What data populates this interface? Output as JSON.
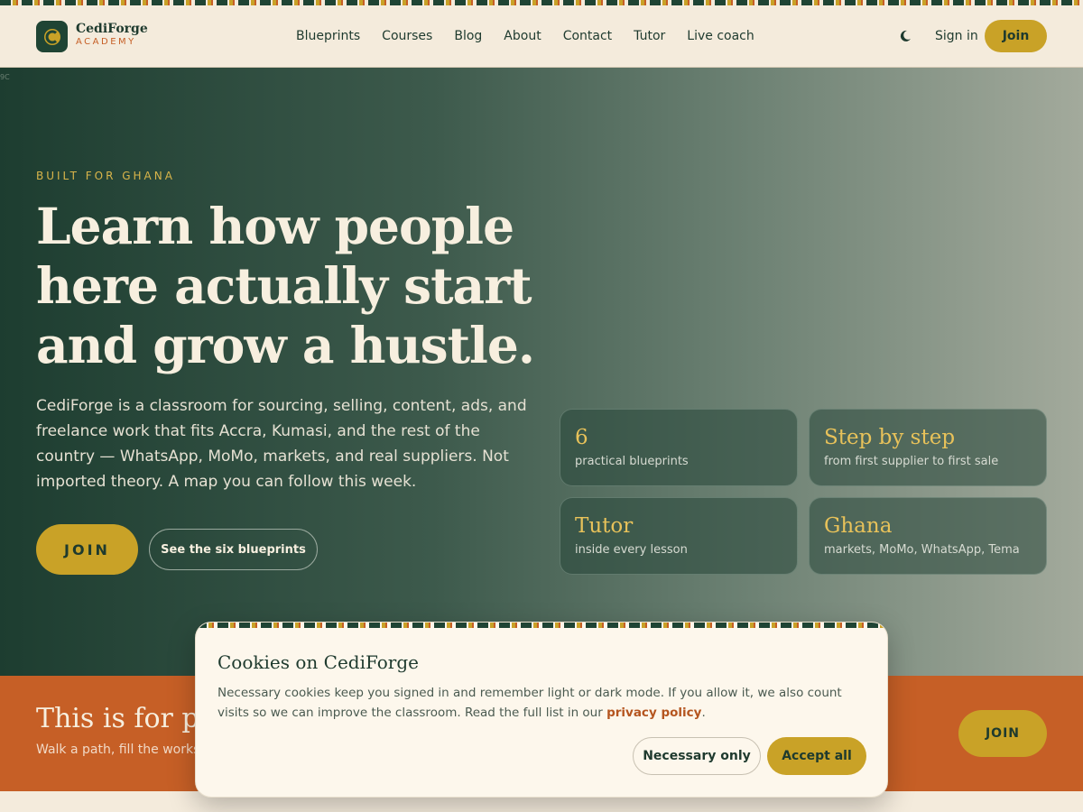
{
  "brand": {
    "name": "CediForge",
    "sub": "ACADEMY"
  },
  "nav": [
    "Blueprints",
    "Courses",
    "Blog",
    "About",
    "Contact",
    "Tutor",
    "Live coach"
  ],
  "header": {
    "signin": "Sign in",
    "join": "Join",
    "theme_icon": "moon-icon"
  },
  "hero": {
    "corner_text": "9C",
    "eyebrow": "BUILT FOR GHANA",
    "headline": "Learn how people here actually start and grow a hustle.",
    "lede": "CediForge is a classroom for sourcing, selling, content, ads, and freelance work that fits Accra, Kumasi, and the rest of the country — WhatsApp, MoMo, markets, and real suppliers. Not imported theory. A map you can follow this week.",
    "join": "JOIN",
    "see_blueprints": "See the six blueprints"
  },
  "stats": [
    {
      "big": "6",
      "small": "practical blueprints"
    },
    {
      "big": "Step by step",
      "small": "from first supplier to first sale"
    },
    {
      "big": "Tutor",
      "small": "inside every lesson"
    },
    {
      "big": "Ghana",
      "small": "markets, MoMo, WhatsApp, Tema"
    }
  ],
  "band": {
    "title": "This is for pe",
    "sub": "Walk a path, fill the worksh",
    "join": "JOIN"
  },
  "cookie": {
    "title": "Cookies on CediForge",
    "body": "Necessary cookies keep you signed in and remember light or dark mode. If you allow it, we also count visits so we can improve the classroom. Read the full list in our ",
    "link": "privacy policy",
    "end": ".",
    "necessary": "Necessary only",
    "accept": "Accept all"
  },
  "colors": {
    "green": "#1f4434",
    "gold": "#c9a227",
    "orange": "#c65f26",
    "cream": "#f4ebdc"
  }
}
